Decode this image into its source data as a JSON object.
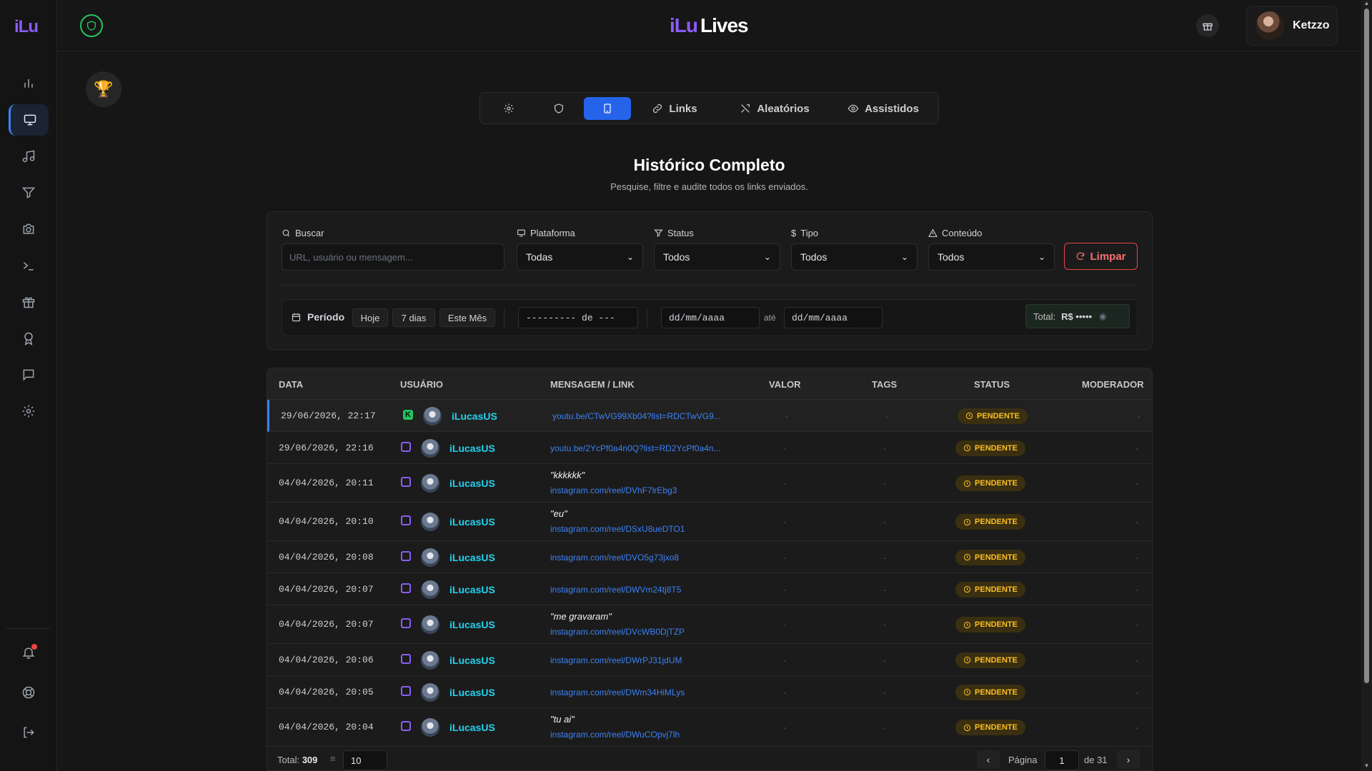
{
  "app": {
    "logo_small": "iLu",
    "brand_part1": "iLu",
    "brand_part2": "Lives"
  },
  "user": {
    "name": "Ketzzo"
  },
  "tabs": [
    {
      "label": "",
      "icon": "gear-icon"
    },
    {
      "label": "",
      "icon": "shield-icon"
    },
    {
      "label": "",
      "icon": "tablet-icon",
      "active": true
    },
    {
      "label": "Links",
      "icon": "link-icon"
    },
    {
      "label": "Aleatórios",
      "icon": "shuffle-icon"
    },
    {
      "label": "Assistidos",
      "icon": "eye-icon"
    }
  ],
  "page": {
    "title": "Histórico Completo",
    "subtitle": "Pesquise, filtre e audite todos os links enviados."
  },
  "filters": {
    "search_label": "Buscar",
    "search_placeholder": "URL, usuário ou mensagem...",
    "platform_label": "Plataforma",
    "platform_value": "Todas",
    "status_label": "Status",
    "status_value": "Todos",
    "type_label": "Tipo",
    "type_value": "Todos",
    "content_label": "Conteúdo",
    "content_value": "Todos",
    "clear_label": "Limpar",
    "period_label": "Período",
    "quick_today": "Hoje",
    "quick_7days": "7 dias",
    "quick_month": "Este Mês",
    "month_picker": "--------- de ---",
    "date_from": "dd/mm/aaaa",
    "date_to": "dd/mm/aaaa",
    "ate": "até",
    "total_label": "Total:",
    "total_value": "R$ •••••"
  },
  "table": {
    "headers": {
      "data": "DATA",
      "usuario": "USUÁRIO",
      "mensagem": "MENSAGEM / LINK",
      "valor": "VALOR",
      "tags": "TAGS",
      "status": "STATUS",
      "moderador": "MODERADOR"
    },
    "rows": [
      {
        "date": "29/06/2026, 22:17",
        "platform": "kick",
        "user": "iLucasUS",
        "message": "",
        "link": "youtu.be/CTwVG99Xb04?list=RDCTwVG9...",
        "valor": "-",
        "tags": "-",
        "status": "PENDENTE",
        "moderador": "-"
      },
      {
        "date": "29/06/2026, 22:16",
        "platform": "twitch",
        "user": "iLucasUS",
        "message": "",
        "link": "youtu.be/2YcPf0a4n0Q?list=RD2YcPf0a4n...",
        "valor": "-",
        "tags": "-",
        "status": "PENDENTE",
        "moderador": "-"
      },
      {
        "date": "04/04/2026, 20:11",
        "platform": "twitch",
        "user": "iLucasUS",
        "message": "\"kkkkkk\"",
        "link": "instagram.com/reel/DVhF7lrEbg3",
        "valor": "-",
        "tags": "-",
        "status": "PENDENTE",
        "moderador": "-"
      },
      {
        "date": "04/04/2026, 20:10",
        "platform": "twitch",
        "user": "iLucasUS",
        "message": "\"eu\"",
        "link": "instagram.com/reel/DSxU8ueDTO1",
        "valor": "-",
        "tags": "-",
        "status": "PENDENTE",
        "moderador": "-"
      },
      {
        "date": "04/04/2026, 20:08",
        "platform": "twitch",
        "user": "iLucasUS",
        "message": "",
        "link": "instagram.com/reel/DVO5g73jxo8",
        "valor": "-",
        "tags": "-",
        "status": "PENDENTE",
        "moderador": "-"
      },
      {
        "date": "04/04/2026, 20:07",
        "platform": "twitch",
        "user": "iLucasUS",
        "message": "",
        "link": "instagram.com/reel/DWVm24tj8T5",
        "valor": "-",
        "tags": "-",
        "status": "PENDENTE",
        "moderador": "-"
      },
      {
        "date": "04/04/2026, 20:07",
        "platform": "twitch",
        "user": "iLucasUS",
        "message": "\"me gravaram\"",
        "link": "instagram.com/reel/DVcWB0DjTZP",
        "valor": "-",
        "tags": "-",
        "status": "PENDENTE",
        "moderador": "-"
      },
      {
        "date": "04/04/2026, 20:06",
        "platform": "twitch",
        "user": "iLucasUS",
        "message": "",
        "link": "instagram.com/reel/DWrPJ31jdUM",
        "valor": "-",
        "tags": "-",
        "status": "PENDENTE",
        "moderador": "-"
      },
      {
        "date": "04/04/2026, 20:05",
        "platform": "twitch",
        "user": "iLucasUS",
        "message": "",
        "link": "instagram.com/reel/DWm34HiMLys",
        "valor": "-",
        "tags": "-",
        "status": "PENDENTE",
        "moderador": "-"
      },
      {
        "date": "04/04/2026, 20:04",
        "platform": "twitch",
        "user": "iLucasUS",
        "message": "\"tu ai\"",
        "link": "instagram.com/reel/DWuCOpvj7lh",
        "valor": "-",
        "tags": "-",
        "status": "PENDENTE",
        "moderador": "-"
      }
    ],
    "footer": {
      "total_label": "Total:",
      "total_value": "309",
      "per_page": "10",
      "page_label": "Página",
      "page_value": "1",
      "page_of": "de 31"
    }
  },
  "colors": {
    "accent": "#2563eb",
    "brand": "#8b5cf6",
    "status_pending": "#fbbf24",
    "username": "#22d3ee",
    "link": "#3b82f6",
    "danger": "#ef4444"
  }
}
